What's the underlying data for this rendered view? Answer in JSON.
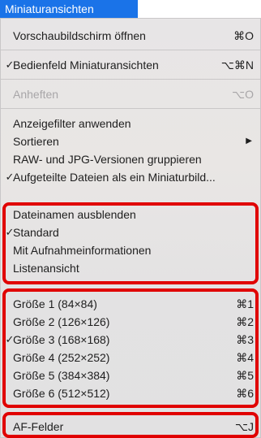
{
  "menu_title": "Miniaturansichten",
  "items": [
    {
      "label": "Vorschaubildschirm öffnen",
      "shortcut": "⌘O",
      "checked": false,
      "disabled": false
    },
    {
      "label": "Bedienfeld Miniaturansichten",
      "shortcut": "⌥⌘N",
      "checked": true,
      "disabled": false
    },
    {
      "label": "Anheften",
      "shortcut": "⌥O",
      "checked": false,
      "disabled": true
    },
    {
      "label": "Anzeigefilter anwenden",
      "shortcut": "",
      "checked": false,
      "disabled": false
    },
    {
      "label": "Sortieren",
      "shortcut": "",
      "submenu": true,
      "checked": false,
      "disabled": false
    },
    {
      "label": "RAW- und JPG-Versionen gruppieren",
      "shortcut": "",
      "checked": false,
      "disabled": false
    },
    {
      "label": "Aufgeteilte Dateien als ein Miniaturbild...",
      "shortcut": "",
      "checked": true,
      "disabled": false
    },
    {
      "label": "Dateinamen ausblenden",
      "shortcut": "",
      "checked": false,
      "disabled": false
    },
    {
      "label": "Standard",
      "shortcut": "",
      "checked": true,
      "disabled": false
    },
    {
      "label": "Mit Aufnahmeinformationen",
      "shortcut": "",
      "checked": false,
      "disabled": false
    },
    {
      "label": "Listenansicht",
      "shortcut": "",
      "checked": false,
      "disabled": false
    },
    {
      "label": "Größe 1 (84×84)",
      "shortcut": "⌘1",
      "checked": false,
      "disabled": false
    },
    {
      "label": "Größe 2 (126×126)",
      "shortcut": "⌘2",
      "checked": false,
      "disabled": false
    },
    {
      "label": "Größe 3 (168×168)",
      "shortcut": "⌘3",
      "checked": true,
      "disabled": false
    },
    {
      "label": "Größe 4 (252×252)",
      "shortcut": "⌘4",
      "checked": false,
      "disabled": false
    },
    {
      "label": "Größe 5 (384×384)",
      "shortcut": "⌘5",
      "checked": false,
      "disabled": false
    },
    {
      "label": "Größe 6 (512×512)",
      "shortcut": "⌘6",
      "checked": false,
      "disabled": false
    },
    {
      "label": "AF-Felder",
      "shortcut": "⌥J",
      "checked": false,
      "disabled": false
    }
  ],
  "check_glyph": "✓",
  "submenu_glyph": "▶",
  "highlight_color": "#e00000"
}
